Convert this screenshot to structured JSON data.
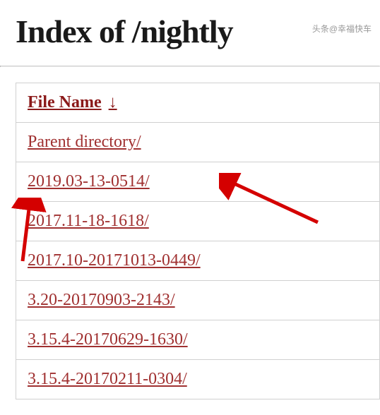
{
  "title": "Index of /nightly",
  "header": {
    "column_label": "File Name",
    "sort_indicator": "↓"
  },
  "files": [
    {
      "name": "Parent directory/"
    },
    {
      "name": "2019.03-13-0514/"
    },
    {
      "name": "2017.11-18-1618/"
    },
    {
      "name": "2017.10-20171013-0449/"
    },
    {
      "name": "3.20-20170903-2143/"
    },
    {
      "name": "3.15.4-20170629-1630/"
    },
    {
      "name": "3.15.4-20170211-0304/"
    }
  ],
  "watermark": "头条@幸福快车"
}
